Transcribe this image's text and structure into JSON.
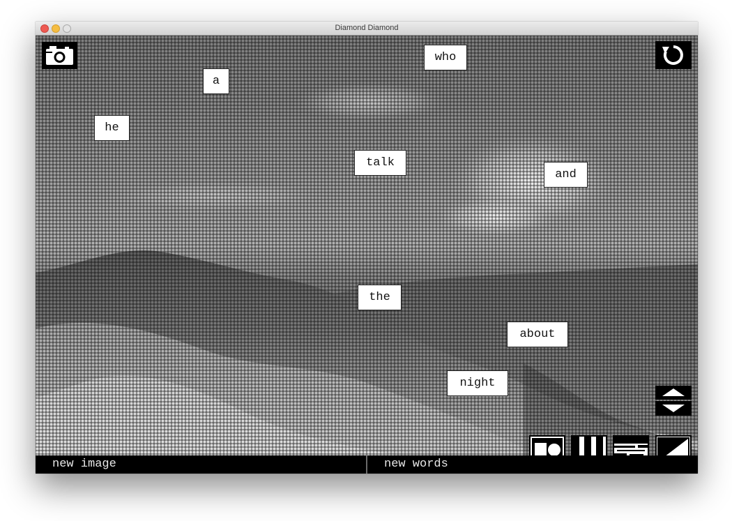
{
  "window": {
    "title": "Diamond Diamond"
  },
  "words": [
    {
      "text": "who"
    },
    {
      "text": "a"
    },
    {
      "text": "he"
    },
    {
      "text": "talk"
    },
    {
      "text": "and"
    },
    {
      "text": "the"
    },
    {
      "text": "about"
    },
    {
      "text": "night"
    }
  ],
  "toolbar": {
    "camera_icon": "camera-icon",
    "reset_icon": "refresh-icon",
    "size_up_icon": "arrow-up-icon",
    "size_down_icon": "arrow-down-icon",
    "filters": [
      "dots-filter",
      "stripes-filter",
      "noise-filter",
      "diagonal-filter"
    ]
  },
  "bottom": {
    "new_image_label": "new image",
    "new_words_label": "new words"
  },
  "colors": {
    "ink": "#000000",
    "paper": "#ffffff",
    "bar_text": "#e8e8e8"
  }
}
